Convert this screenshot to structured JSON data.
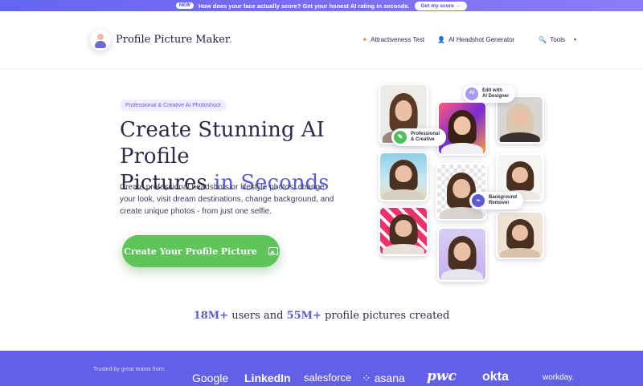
{
  "announcement": {
    "badge": "NEW",
    "text": "How does your face actually score? Get your honest AI rating in seconds.",
    "button": "Get my score →"
  },
  "header": {
    "brand": "Profile Picture Maker",
    "brand_suffix": ".",
    "nav": [
      {
        "label": "Attractiveness Test",
        "icon": "sparkle-icon"
      },
      {
        "label": "AI Headshot Generator",
        "icon": "person-icon"
      },
      {
        "label": "Tools",
        "icon": "magic-wand-icon",
        "caret": "▼"
      }
    ]
  },
  "hero": {
    "tag": "Professional & Creative AI Photoshoot",
    "title_line1": "Create Stunning AI Profile",
    "title_line2_plain": "Pictures ",
    "title_line2_accent": "in Seconds",
    "description": "Create professional headshots or lifestyle photos, change your look, visit dream destinations, change background, and create unique photos - from just one selfie.",
    "cta_label": "Create Your Profile Picture"
  },
  "feature_pills": {
    "edit_line1": "Edit with",
    "edit_line2": "AI Designer",
    "edit_badge": "AI",
    "prof_line1": "Professional",
    "prof_line2": "& Creative",
    "bg_line1": "Background",
    "bg_line2": "Remover"
  },
  "stats": {
    "users": "18M+",
    "users_text": " users and ",
    "pictures": "55M+",
    "pictures_text": " profile pictures created"
  },
  "trusted": {
    "label": "Trusted by great teams from:",
    "logos": [
      "Google",
      "LinkedIn",
      "salesforce",
      "asana",
      "pwc",
      "okta",
      "workday."
    ]
  },
  "colors": {
    "accent": "#5b5bd6",
    "cta_green": "#5fc55a",
    "trusted_bg": "#6360e8"
  }
}
